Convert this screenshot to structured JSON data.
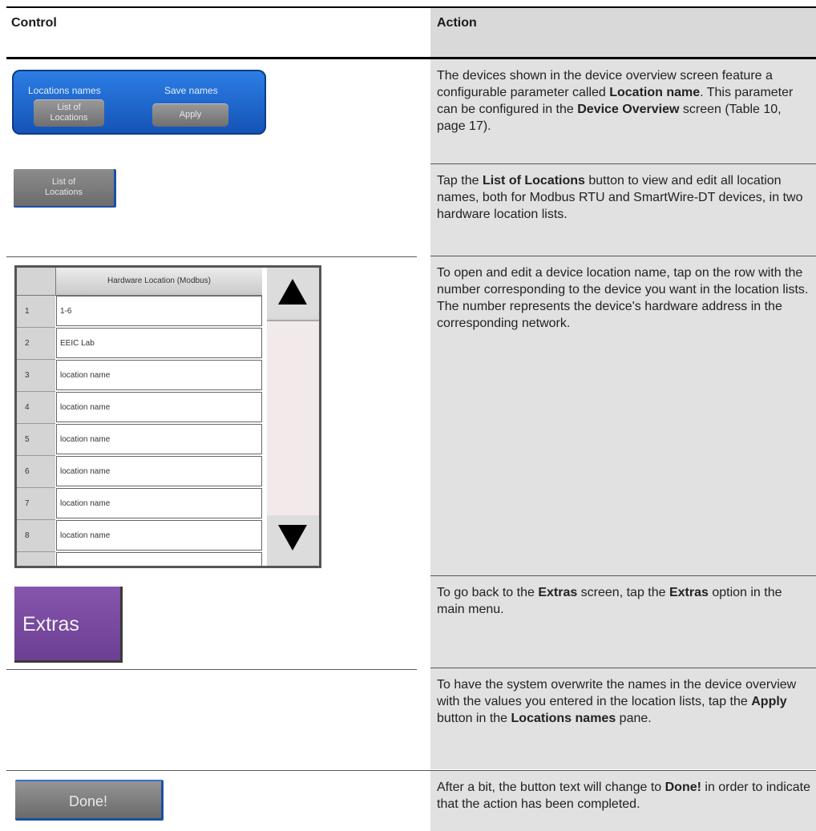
{
  "header": {
    "control": "Control",
    "action": "Action"
  },
  "location_pane": {
    "locations_names_label": "Locations names",
    "save_names_label": "Save names",
    "list_button_line1": "List of",
    "list_button_line2": "Locations",
    "apply_button": "Apply"
  },
  "list_button": {
    "line1": "List of",
    "line2": "Locations"
  },
  "hardware_list": {
    "header": "Hardware Location (Modbus)",
    "rows": [
      {
        "num": "1",
        "value": "1-6"
      },
      {
        "num": "2",
        "value": "EEIC Lab"
      },
      {
        "num": "3",
        "value": "location name"
      },
      {
        "num": "4",
        "value": "location name"
      },
      {
        "num": "5",
        "value": "location name"
      },
      {
        "num": "6",
        "value": "location name"
      },
      {
        "num": "7",
        "value": "location name"
      },
      {
        "num": "8",
        "value": "location name"
      }
    ]
  },
  "extras_button": "Extras",
  "done_button": "Done!",
  "actions": {
    "r1": {
      "t1": "The devices shown in the device overview screen feature a configurable parameter called ",
      "b1": "Location name",
      "t2": ". This parameter can be configured in the ",
      "b2": "Device Overview",
      "t3": " screen (Table 10, page 17)."
    },
    "r2": {
      "t1": "Tap the ",
      "b1": "List of Locations",
      "t2": " button to view and edit all location names, both for Modbus RTU and SmartWire-DT devices, in two hardware location lists."
    },
    "r3": {
      "t1": "To open and edit a device location name, tap on the row with the number corresponding to the device you want in the location lists. The number represents the device's hardware address in the corresponding network."
    },
    "r4": {
      "t1": "To go back to the ",
      "b1": "Extras",
      "t2": " screen, tap the ",
      "b2": "Extras",
      "t3": " option in the main menu."
    },
    "r5": {
      "t1": "To have the system overwrite the names in the device overview with the values you entered in the location lists, tap the ",
      "b1": "Apply",
      "t2": " button in the ",
      "b2": "Locations names",
      "t3": " pane."
    },
    "r6": {
      "t1": "After a bit, the button text will change to ",
      "b1": "Done!",
      "t2": " in order to indicate that the action has been completed."
    }
  }
}
